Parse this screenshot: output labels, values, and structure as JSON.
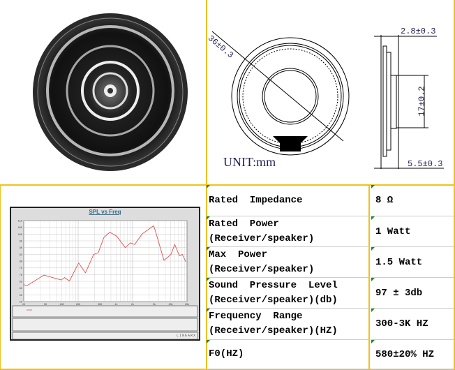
{
  "drawing": {
    "diameter": "36±0.3",
    "thickness_top": "2.8±0.3",
    "magnet_diameter": "17±0.2",
    "depth": "5.5±0.3",
    "unit": "UNIT:mm"
  },
  "specs": [
    {
      "label": "Rated  Impedance",
      "value": "8 Ω"
    },
    {
      "label": "Rated  Power\n(Receiver/speaker)",
      "value": "1 Watt"
    },
    {
      "label": "Max  Power\n(Receiver/speaker)",
      "value": "1.5 Watt"
    },
    {
      "label": "Sound  Pressure  Level\n(Receiver/speaker)(db)",
      "value": "97 ± 3db"
    },
    {
      "label": "Frequency  Range\n(Receiver/speaker)(HZ)",
      "value": "300-3K HZ"
    },
    {
      "label": "F0(HZ)",
      "value": "580±20% HZ"
    }
  ],
  "chart_data": {
    "type": "line",
    "title": "SPL vs Freq",
    "xscale": "log",
    "xlim": [
      20,
      20000
    ],
    "ylim": [
      50,
      110
    ],
    "grid": true,
    "series": [
      {
        "x": [
          20,
          22.7,
          47,
          98,
          113,
          138,
          204,
          272,
          385,
          467,
          594,
          762,
          1026,
          1462,
          1828,
          2183,
          3000,
          4880,
          5360,
          7540,
          8730,
          10100,
          11900,
          14500,
          16400,
          19000
        ],
        "y": [
          62.6,
          61.7,
          69.6,
          66,
          67.8,
          65.2,
          78.6,
          71.3,
          84.9,
          86.2,
          97.5,
          101.4,
          98.4,
          90,
          93.5,
          92.3,
          100.2,
          106.2,
          101,
          80.6,
          82.7,
          84.9,
          92.3,
          83.9,
          84.9,
          79.5
        ]
      }
    ],
    "colors": {
      "spl": "#e05050",
      "impedance": "#f2b8b8"
    },
    "footer_brand": "LINEARX"
  }
}
